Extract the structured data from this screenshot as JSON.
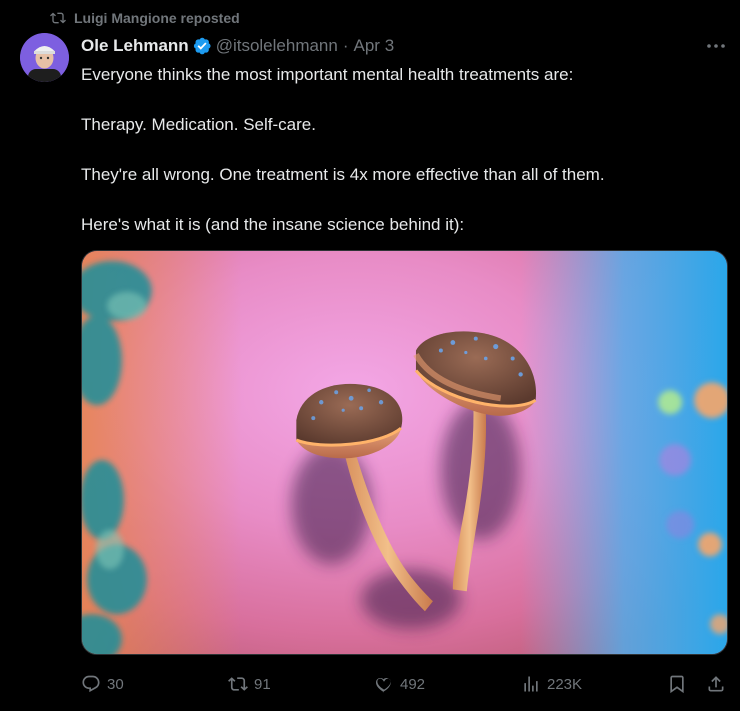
{
  "repost": {
    "icon": "repost-icon",
    "text": "Luigi Mangione reposted"
  },
  "author": {
    "name": "Ole Lehmann",
    "verified_icon": "verified-badge-icon",
    "handle": "@itsolelehmann",
    "separator": "·",
    "date": "Apr 3"
  },
  "more_icon": "more-dots-icon",
  "tweet": {
    "paragraphs": [
      "Everyone thinks the most important mental health treatments are:",
      "Therapy. Medication. Self-care.",
      "They're all wrong. One treatment is 4x more effective than all of them.",
      "Here's what it is (and the insane science behind it):"
    ]
  },
  "media": {
    "icon": "mushroom-photo"
  },
  "actions": {
    "reply_count": "30",
    "repost_count": "91",
    "like_count": "492",
    "views_count": "223K"
  },
  "colors": {
    "background": "#000000",
    "text": "#e7e9ea",
    "muted": "#71767b",
    "verified": "#1d9bf0"
  }
}
